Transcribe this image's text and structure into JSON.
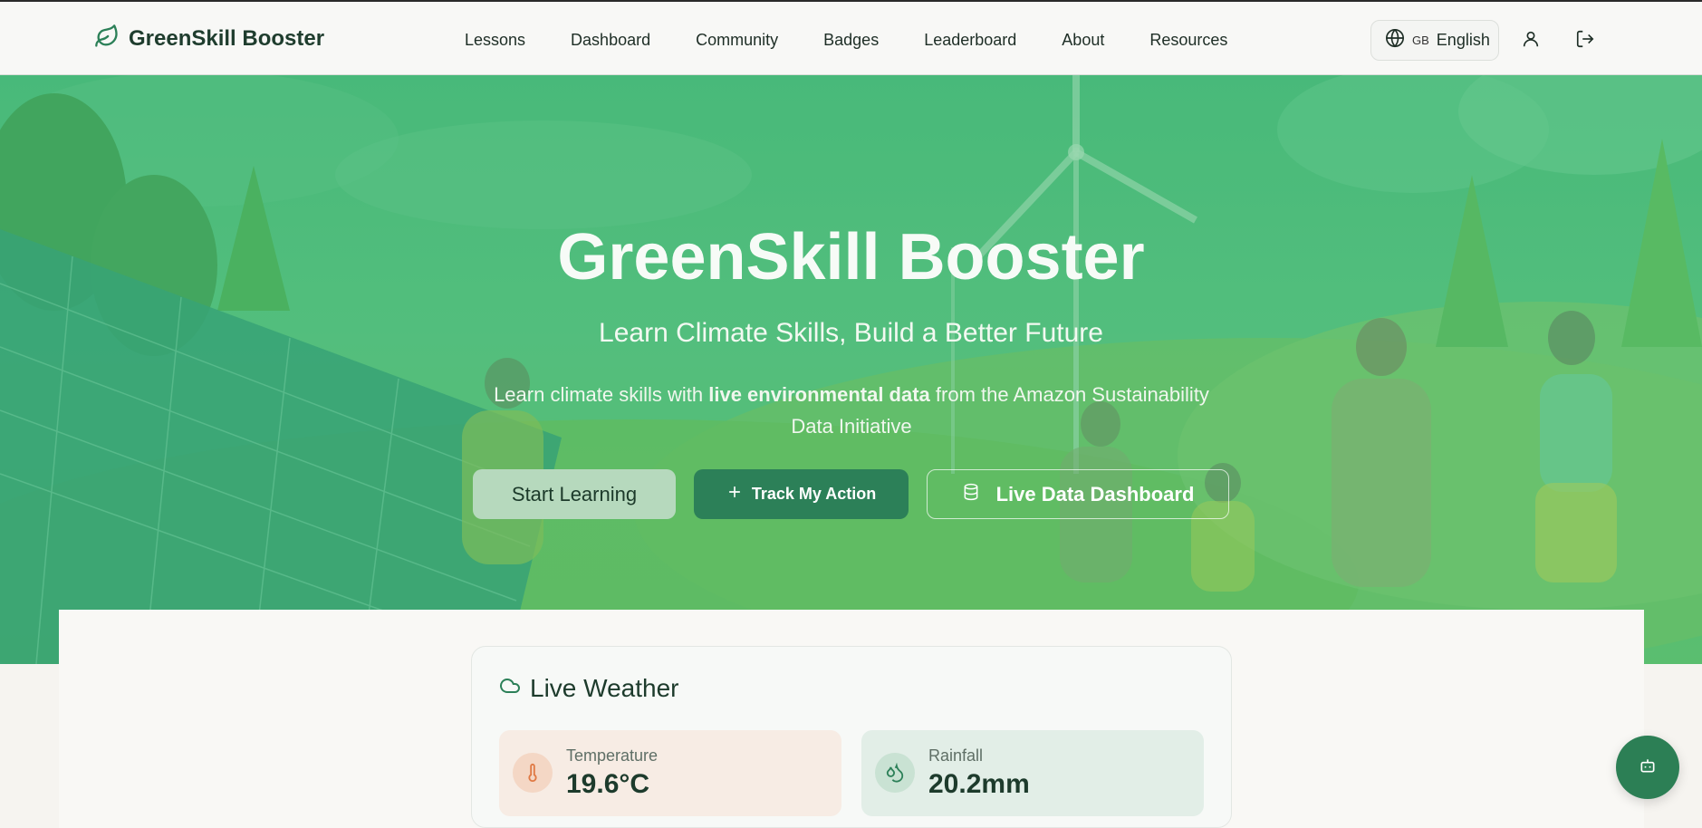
{
  "header": {
    "brand": "GreenSkill Booster",
    "nav": [
      "Lessons",
      "Dashboard",
      "Community",
      "Badges",
      "Leaderboard",
      "About",
      "Resources"
    ],
    "language_code": "GB",
    "language_label": "English"
  },
  "hero": {
    "title": "GreenSkill Booster",
    "subtitle": "Learn Climate Skills, Build a Better Future",
    "desc_before": "Learn climate skills with ",
    "desc_bold": "live environmental data",
    "desc_after": " from the Amazon Sustainability Data Initiative",
    "btn_start": "Start Learning",
    "btn_track": "Track My Action",
    "btn_live": "Live Data Dashboard"
  },
  "weather": {
    "title": "Live Weather",
    "temperature_label": "Temperature",
    "temperature_value": "19.6°C",
    "rainfall_label": "Rainfall",
    "rainfall_value": "20.2mm"
  },
  "colors": {
    "brand_green": "#2c8058",
    "hero_green": "#4fbb7b"
  }
}
